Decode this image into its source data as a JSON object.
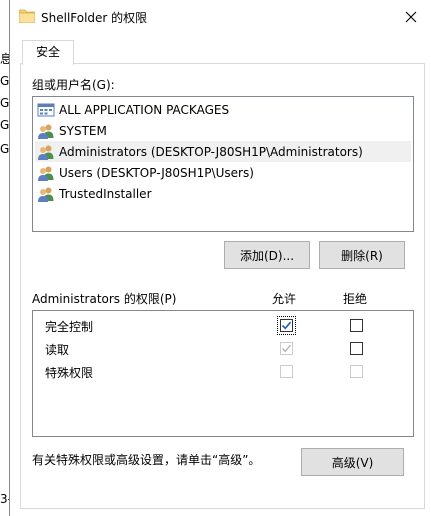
{
  "background": {
    "fragments": [
      "息",
      "G",
      "G",
      "G",
      "G"
    ],
    "bottom_fragment": "3-"
  },
  "window": {
    "title": "ShellFolder 的权限",
    "close_icon": "close-icon"
  },
  "tab": {
    "label": "安全"
  },
  "groups": {
    "label": "组或用户名(G):",
    "items": [
      {
        "name": "ALL APPLICATION PACKAGES",
        "icon": "app-packages-icon"
      },
      {
        "name": "SYSTEM",
        "icon": "users-icon"
      },
      {
        "name": "Administrators (DESKTOP-J80SH1P\\Administrators)",
        "icon": "users-icon",
        "selected": true
      },
      {
        "name": "Users (DESKTOP-J80SH1P\\Users)",
        "icon": "users-icon"
      },
      {
        "name": "TrustedInstaller",
        "icon": "users-icon"
      }
    ]
  },
  "buttons": {
    "add": "添加(D)...",
    "remove": "删除(R)",
    "advanced": "高级(V)"
  },
  "permissions": {
    "label": "Administrators 的权限(P)",
    "allow_header": "允许",
    "deny_header": "拒绝",
    "rows": [
      {
        "name": "完全控制",
        "allow": true,
        "allow_enabled": true,
        "deny": false,
        "deny_enabled": true
      },
      {
        "name": "读取",
        "allow": true,
        "allow_enabled": false,
        "deny": false,
        "deny_enabled": true
      },
      {
        "name": "特殊权限",
        "allow": false,
        "allow_enabled": false,
        "deny": false,
        "deny_enabled": false
      }
    ]
  },
  "advanced_hint": "有关特殊权限或高级设置，请单击“高级”。",
  "colors": {
    "check_blue": "#1f5fbf",
    "disabled": "#cccccc",
    "button_face": "#e1e1e1"
  }
}
